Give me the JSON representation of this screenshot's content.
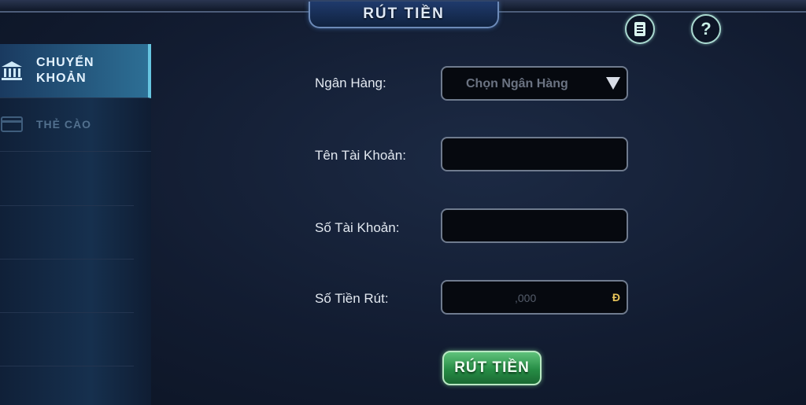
{
  "header": {
    "title": "RÚT TIỀN",
    "history_icon": "document-icon",
    "help_icon": "question-icon",
    "help_glyph": "?"
  },
  "sidebar": {
    "items": [
      {
        "label_line1": "CHUYỂN",
        "label_line2": "KHOẢN",
        "icon": "bank-icon",
        "active": true
      },
      {
        "label": "THẺ CÀO",
        "icon": "card-icon",
        "active": false
      }
    ]
  },
  "form": {
    "bank_label": "Ngân Hàng:",
    "bank_select": {
      "value": "Chọn Ngân Hàng",
      "icon": "dropdown-arrow-icon"
    },
    "account_name_label": "Tên Tài Khoản:",
    "account_name_value": "",
    "account_number_label": "Số Tài Khoản:",
    "account_number_value": "",
    "amount_label": "Số Tiền Rút:",
    "amount_placeholder": ",000",
    "currency_symbol": "Đ",
    "submit_label": "RÚT TIỀN"
  },
  "colors": {
    "accent_cyan": "#66c5e0",
    "button_green": "#268c45",
    "title_blue": "#1f3a6c"
  }
}
